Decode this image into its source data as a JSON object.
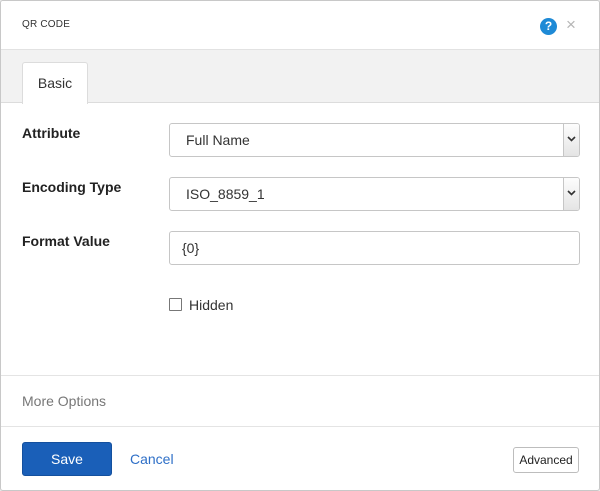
{
  "dialog": {
    "title": "QR CODE",
    "help_icon": "question-mark-icon",
    "close_icon": "close-icon",
    "help_glyph": "?",
    "close_glyph": "×"
  },
  "tabs": [
    {
      "label": "Basic",
      "active": true
    }
  ],
  "form": {
    "attribute": {
      "label": "Attribute",
      "value": "Full Name"
    },
    "encoding_type": {
      "label": "Encoding Type",
      "value": "ISO_8859_1"
    },
    "format_value": {
      "label": "Format Value",
      "value": "{0}"
    },
    "hidden": {
      "label": "Hidden",
      "checked": false
    }
  },
  "more_options": "More Options",
  "footer": {
    "save_label": "Save",
    "cancel_label": "Cancel",
    "advanced_label": "Advanced"
  },
  "colors": {
    "accent": "#1a5fb8",
    "help_icon": "#1e8ad6",
    "link": "#2e6fc7"
  }
}
